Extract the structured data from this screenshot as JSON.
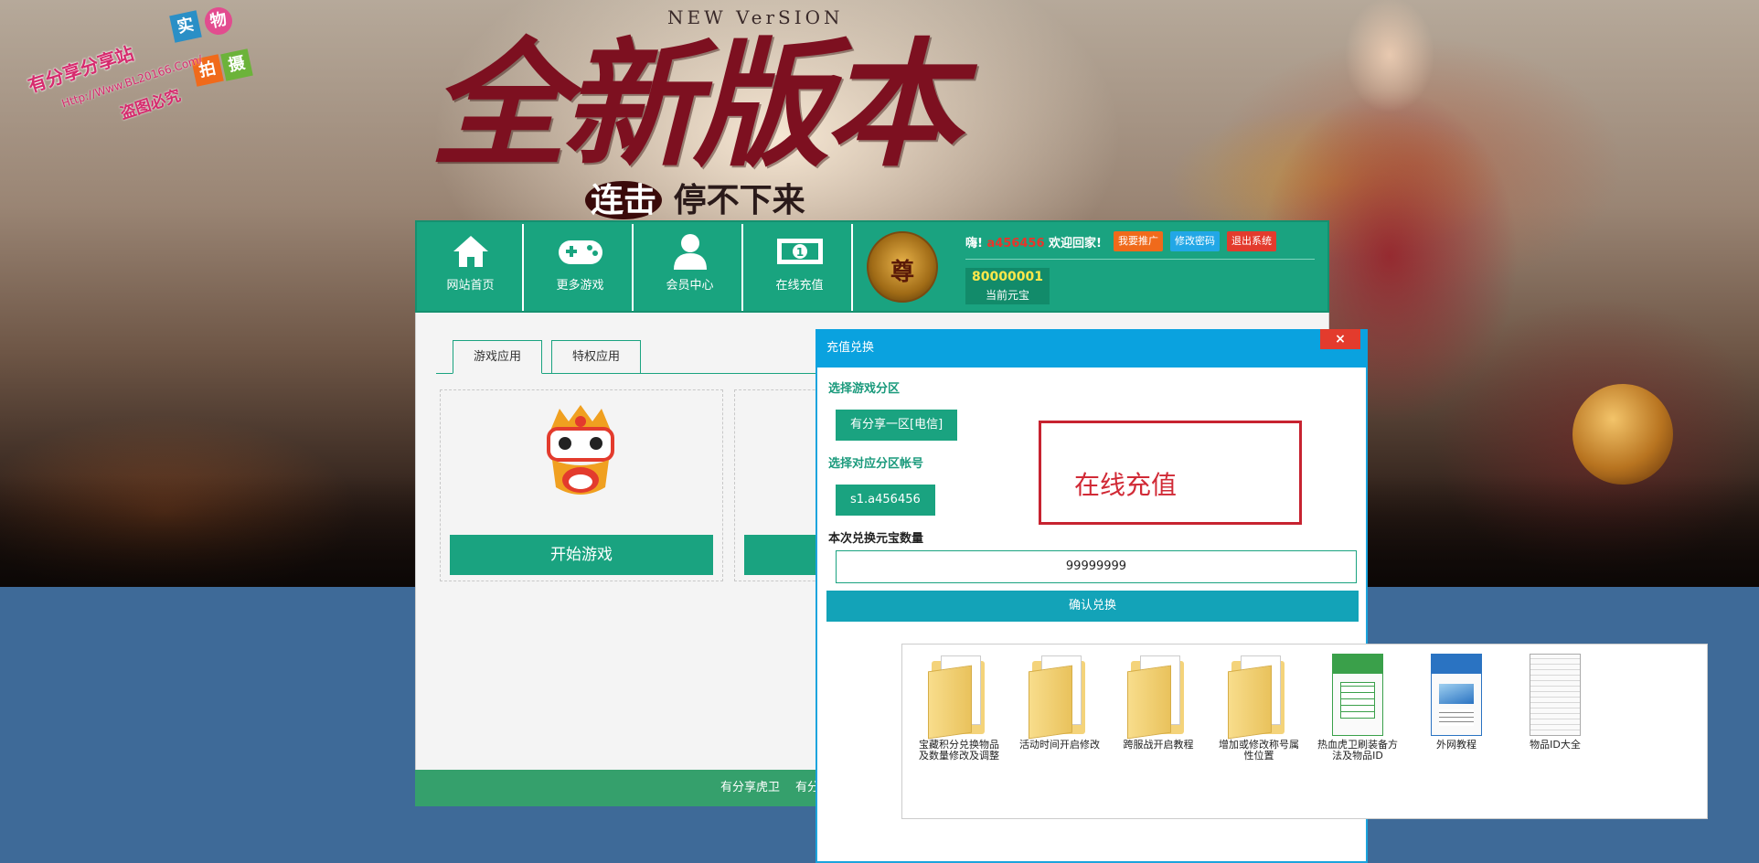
{
  "banner": {
    "title": "全新版本",
    "new_version": "NEW VerSION",
    "subtitle_hl": "连击",
    "subtitle": "停不下来",
    "watermark": {
      "line1": "有分享分享站",
      "line2": "Http://Www.BL20166.Com/",
      "line3": "盗图必究",
      "badges": [
        "实",
        "物",
        "拍",
        "摄"
      ]
    }
  },
  "nav": {
    "items": [
      {
        "label": "网站首页",
        "icon": "home-icon"
      },
      {
        "label": "更多游戏",
        "icon": "gamepad-icon"
      },
      {
        "label": "会员中心",
        "icon": "user-icon"
      },
      {
        "label": "在线充值",
        "icon": "money-icon"
      }
    ]
  },
  "user": {
    "avatar_text": "尊",
    "greet_prefix": "嗨!",
    "username": "a456456",
    "greet_suffix": "欢迎回家!",
    "buttons": [
      {
        "label": "我要推广",
        "color": "#f06a1b"
      },
      {
        "label": "修改密码",
        "color": "#22a7e6"
      },
      {
        "label": "退出系统",
        "color": "#e33b2d"
      }
    ],
    "balance": "80000001",
    "balance_label": "当前元宝"
  },
  "tabs": [
    "游戏应用",
    "特权应用"
  ],
  "game_card": {
    "start_label": "开始游戏"
  },
  "footer": {
    "text1": "有分享虎卫",
    "text2": "有分"
  },
  "modal": {
    "title": "充值兑换",
    "close": "×",
    "zone_label": "选择游戏分区",
    "zone_value": "有分享一区[电信]",
    "account_label": "选择对应分区帐号",
    "account_value": "s1.a456456",
    "amount_label": "本次兑换元宝数量",
    "amount_value": "99999999",
    "confirm_label": "确认兑换",
    "annotation": "在线充值"
  },
  "files": [
    {
      "name": "宝藏积分兑换物品及数量修改及调整",
      "type": "folder"
    },
    {
      "name": "活动时间开启修改",
      "type": "folder"
    },
    {
      "name": "跨服战开启教程",
      "type": "folder"
    },
    {
      "name": "增加或修改称号属性位置",
      "type": "folder"
    },
    {
      "name": "热血虎卫刷装备方法及物品ID",
      "type": "spreadsheet"
    },
    {
      "name": "外网教程",
      "type": "document"
    },
    {
      "name": "物品ID大全",
      "type": "text"
    }
  ],
  "colors": {
    "primary": "#1aa380",
    "modal_head": "#0aa2df",
    "annotation": "#c72330",
    "confirm": "#13a3b8"
  }
}
